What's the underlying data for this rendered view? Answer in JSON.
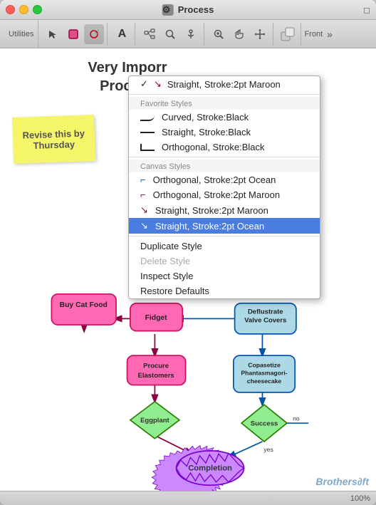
{
  "window": {
    "title": "Process",
    "controls": {
      "close": "close",
      "minimize": "minimize",
      "maximize": "maximize"
    }
  },
  "toolbar": {
    "utilities_label": "Utilities",
    "front_label": "Front",
    "buttons": [
      "select",
      "shape",
      "draw",
      "text",
      "diagram",
      "pointer",
      "hand",
      "pan"
    ]
  },
  "chart": {
    "title_line1": "Very Imporr",
    "title_line2": "Process",
    "sticky_note": "Revise this by Thursday"
  },
  "dropdown": {
    "checked_item": "Straight, Stroke:2pt Maroon",
    "section_favorites": "Favorite Styles",
    "favorites": [
      {
        "label": "Curved, Stroke:Black",
        "type": "curved"
      },
      {
        "label": "Straight, Stroke:Black",
        "type": "straight"
      },
      {
        "label": "Orthogonal, Stroke:Black",
        "type": "ortho"
      }
    ],
    "section_canvas": "Canvas Styles",
    "canvas_items": [
      {
        "label": "Orthogonal, Stroke:2pt Ocean",
        "type": "ortho-ocean"
      },
      {
        "label": "Orthogonal, Stroke:2pt Maroon",
        "type": "ortho-maroon"
      },
      {
        "label": "Straight, Stroke:2pt Maroon",
        "type": "straight-maroon"
      }
    ],
    "selected_item": "Straight, Stroke:2pt Ocean",
    "actions": [
      "Duplicate Style",
      "Delete Style",
      "Inspect Style",
      "Restore Defaults"
    ]
  },
  "flowchart": {
    "nodes": [
      {
        "id": "buy-cat-food",
        "label": "Buy Cat Food",
        "shape": "rounded-rect",
        "color": "#ff69b4",
        "border": "#cc1060"
      },
      {
        "id": "fidget",
        "label": "Fidget",
        "shape": "rounded-rect",
        "color": "#ff69b4",
        "border": "#cc1060"
      },
      {
        "id": "deflustrate",
        "label": "Deflustrate Valve Covers",
        "shape": "rounded-rect",
        "color": "#add8e6",
        "border": "#0055aa"
      },
      {
        "id": "procure",
        "label": "Procure Elastomers",
        "shape": "rounded-rect",
        "color": "#ff69b4",
        "border": "#cc1060"
      },
      {
        "id": "copasetize",
        "label": "Copasetize Phantasmagori-cheesecake",
        "shape": "rounded-rect",
        "color": "#add8e6",
        "border": "#0055aa"
      },
      {
        "id": "eggplant",
        "label": "Eggplant",
        "shape": "diamond",
        "color": "#90ee90",
        "border": "#2a8000"
      },
      {
        "id": "success",
        "label": "Success",
        "shape": "diamond",
        "color": "#90ee90",
        "border": "#2a8000"
      },
      {
        "id": "completion",
        "label": "Completion",
        "shape": "burst",
        "color": "#cc88ff",
        "border": "#7700cc"
      }
    ]
  },
  "statusbar": {
    "zoom": "100%"
  },
  "watermark": "Brothers∂ft"
}
